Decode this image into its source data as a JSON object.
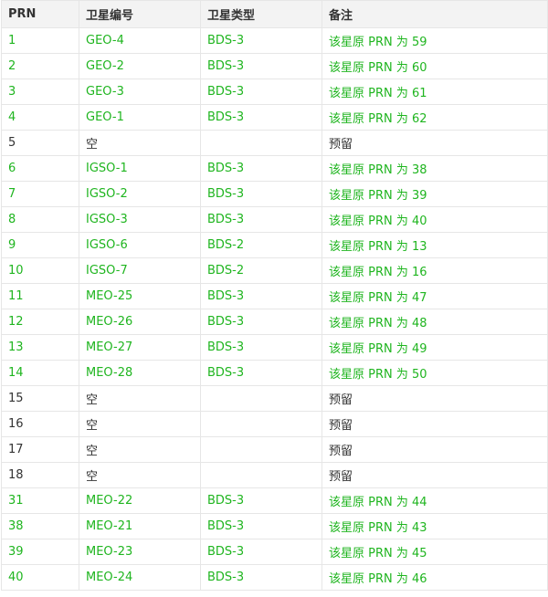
{
  "colors": {
    "green_text": "#1fb51f",
    "plain_text": "#333333",
    "header_bg": "#f3f3f3",
    "border": "#e6e6e6"
  },
  "table": {
    "headers": [
      "PRN",
      "卫星编号",
      "卫星类型",
      "备注"
    ],
    "rows": [
      {
        "style": "green",
        "cells": [
          "1",
          "GEO-4",
          "BDS-3",
          "该星原 PRN 为 59"
        ]
      },
      {
        "style": "green",
        "cells": [
          "2",
          "GEO-2",
          "BDS-3",
          "该星原 PRN 为 60"
        ]
      },
      {
        "style": "green",
        "cells": [
          "3",
          "GEO-3",
          "BDS-3",
          "该星原 PRN 为 61"
        ]
      },
      {
        "style": "green",
        "cells": [
          "4",
          "GEO-1",
          "BDS-3",
          "该星原 PRN 为 62"
        ]
      },
      {
        "style": "plain",
        "cells": [
          "5",
          "空",
          "",
          "预留"
        ]
      },
      {
        "style": "green",
        "cells": [
          "6",
          "IGSO-1",
          "BDS-3",
          "该星原 PRN 为 38"
        ]
      },
      {
        "style": "green",
        "cells": [
          "7",
          "IGSO-2",
          "BDS-3",
          "该星原 PRN 为 39"
        ]
      },
      {
        "style": "green",
        "cells": [
          "8",
          "IGSO-3",
          "BDS-3",
          "该星原 PRN 为 40"
        ]
      },
      {
        "style": "green",
        "cells": [
          "9",
          "IGSO-6",
          "BDS-2",
          "该星原 PRN 为 13"
        ]
      },
      {
        "style": "green",
        "cells": [
          "10",
          "IGSO-7",
          "BDS-2",
          "该星原 PRN 为 16"
        ]
      },
      {
        "style": "green",
        "cells": [
          "11",
          "MEO-25",
          "BDS-3",
          "该星原 PRN 为 47"
        ]
      },
      {
        "style": "green",
        "cells": [
          "12",
          "MEO-26",
          "BDS-3",
          "该星原 PRN 为 48"
        ]
      },
      {
        "style": "green",
        "cells": [
          "13",
          "MEO-27",
          "BDS-3",
          "该星原 PRN 为 49"
        ]
      },
      {
        "style": "green",
        "cells": [
          "14",
          "MEO-28",
          "BDS-3",
          "该星原 PRN 为 50"
        ]
      },
      {
        "style": "plain",
        "cells": [
          "15",
          "空",
          "",
          "预留"
        ]
      },
      {
        "style": "plain",
        "cells": [
          "16",
          "空",
          "",
          "预留"
        ]
      },
      {
        "style": "plain",
        "cells": [
          "17",
          "空",
          "",
          "预留"
        ]
      },
      {
        "style": "plain",
        "cells": [
          "18",
          "空",
          "",
          "预留"
        ]
      },
      {
        "style": "green",
        "cells": [
          "31",
          "MEO-22",
          "BDS-3",
          "该星原 PRN 为 44"
        ]
      },
      {
        "style": "green",
        "cells": [
          "38",
          "MEO-21",
          "BDS-3",
          "该星原 PRN 为 43"
        ]
      },
      {
        "style": "green",
        "cells": [
          "39",
          "MEO-23",
          "BDS-3",
          "该星原 PRN 为 45"
        ]
      },
      {
        "style": "green",
        "cells": [
          "40",
          "MEO-24",
          "BDS-3",
          "该星原 PRN 为 46"
        ]
      }
    ]
  }
}
